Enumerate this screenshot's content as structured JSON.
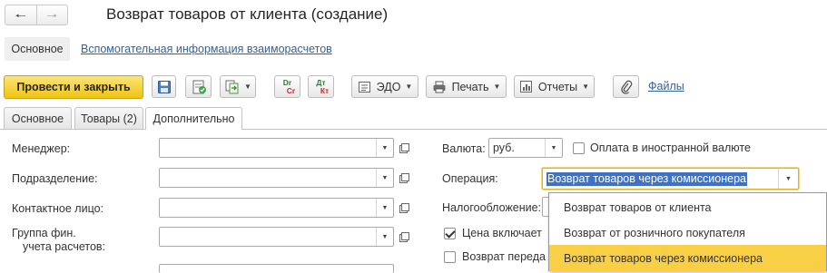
{
  "window": {
    "title": "Возврат товаров от клиента (создание)"
  },
  "icons": {
    "back": "arrow-left-icon",
    "forward": "arrow-right-icon",
    "save": "floppy-disk-icon",
    "post": "document-post-icon",
    "create_based": "create-based-on-icon",
    "dr_cr": "debit-credit-icon",
    "dt_kt": "dt-kt-icon",
    "edo": "edo-icon",
    "print": "printer-icon",
    "reports": "reports-icon",
    "attach": "paperclip-icon",
    "open": "open-form-icon",
    "dropdown": "chevron-down-icon"
  },
  "colors": {
    "primary_button": "#f1c40f",
    "link": "#35619a",
    "selection": "#3d72c7",
    "dropdown_selected": "#f8cf45",
    "focus_border": "#e0b12a"
  },
  "nav": {
    "main_label": "Основное",
    "link_label": "Вспомогательная информация взаиморасчетов"
  },
  "toolbar": {
    "post_close_label": "Провести и закрыть",
    "dr_top": "Dr",
    "dr_bottom": "Cr",
    "dt_top": "Дт",
    "dt_bottom": "Кт",
    "edo_label": "ЭДО",
    "print_label": "Печать",
    "reports_label": "Отчеты",
    "files_label": "Файлы"
  },
  "tabs": [
    {
      "label": "Основное",
      "active": false
    },
    {
      "label": "Товары (2)",
      "active": false
    },
    {
      "label": "Дополнительно",
      "active": true
    }
  ],
  "form": {
    "manager_label": "Менеджер:",
    "manager_value": "",
    "department_label": "Подразделение:",
    "department_value": "",
    "contact_label": "Контактное лицо:",
    "contact_value": "",
    "group_label_line1": "Группа фин.",
    "group_label_line2": "учета расчетов:",
    "group_value": "",
    "currency_label": "Валюта:",
    "currency_value": "руб.",
    "foreign_currency_label": "Оплата в иностранной валюте",
    "foreign_currency_checked": false,
    "operation_label": "Операция:",
    "operation_value": "Возврат товаров через комиссионера",
    "taxation_label": "Налогообложение:",
    "price_includes_label": "Цена включает",
    "price_includes_checked": true,
    "return_transfer_label": "Возврат переда",
    "return_transfer_checked": false
  },
  "operation_options": [
    {
      "label": "Возврат товаров от клиента",
      "selected": false
    },
    {
      "label": "Возврат от розничного покупателя",
      "selected": false
    },
    {
      "label": "Возврат товаров через комиссионера",
      "selected": true
    }
  ]
}
